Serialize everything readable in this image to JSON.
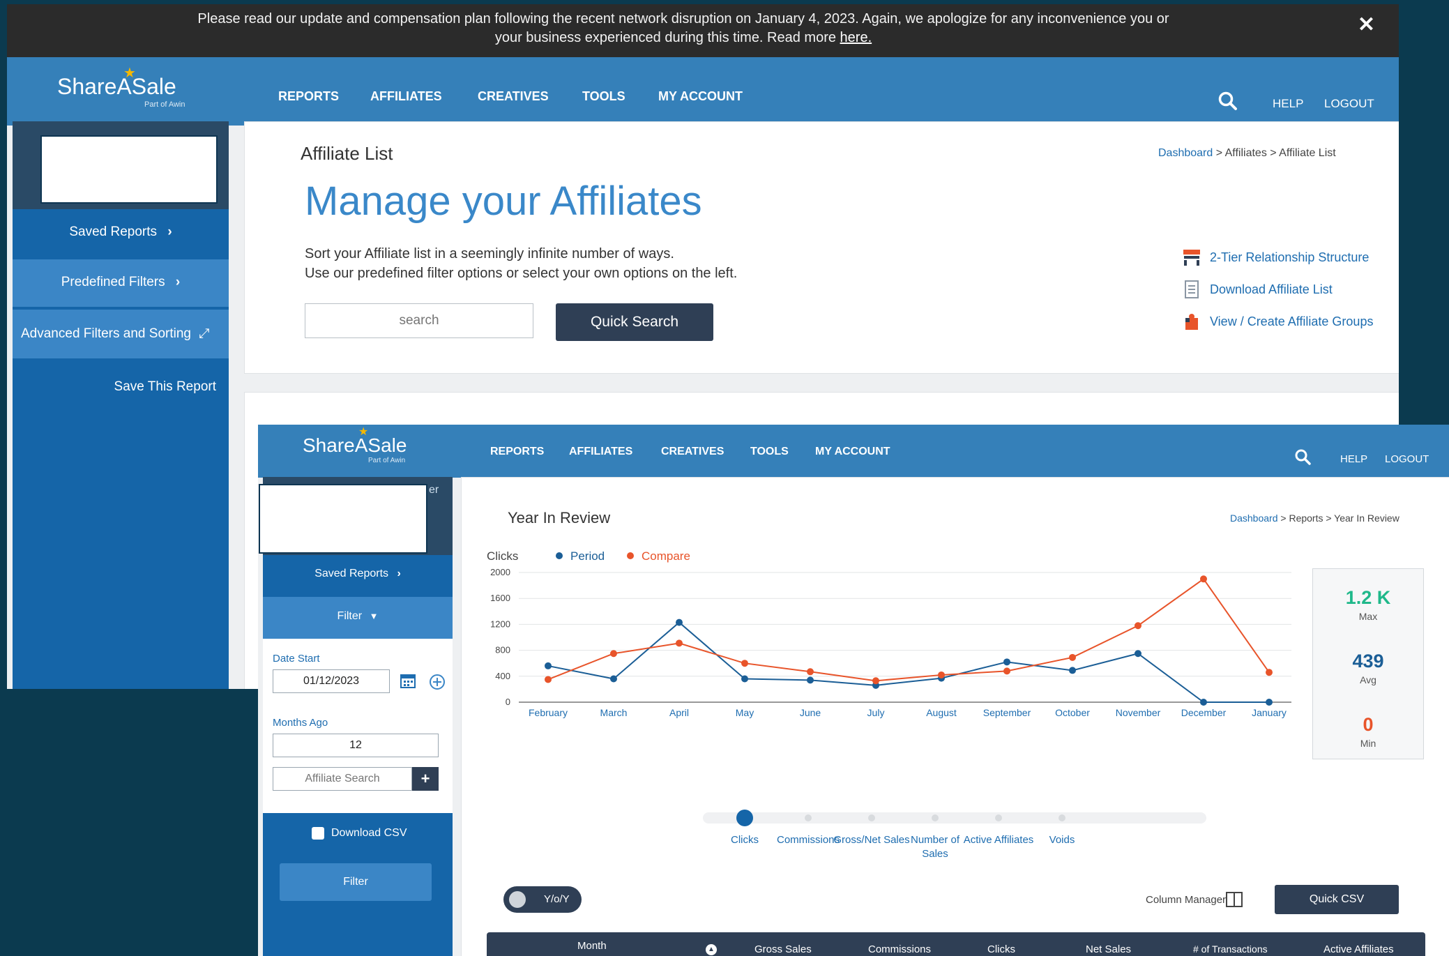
{
  "notice": {
    "line1": "Please read our update and compensation plan following the recent network disruption on January 4, 2023. Again, we apologize for any inconvenience you or",
    "line2": "your business experienced during this time. Read more",
    "link": "here.",
    "close": "✕"
  },
  "brand": {
    "name": "ShareASale",
    "sub": "Part of Awin",
    "star": "★"
  },
  "nav": [
    "REPORTS",
    "AFFILIATES",
    "CREATIVES",
    "TOOLS",
    "MY ACCOUNT"
  ],
  "util": {
    "help": "HELP",
    "logout": "LOGOUT"
  },
  "affiliate_page": {
    "sidebar": {
      "saved_reports": "Saved Reports",
      "predefined_filters": "Predefined Filters",
      "advanced": "Advanced Filters and Sorting",
      "save_report": "Save This Report"
    },
    "section_title": "Affiliate List",
    "breadcrumb": {
      "home": "Dashboard",
      "rest": " > Affiliates > Affiliate List"
    },
    "heading": "Manage your Affiliates",
    "desc1": "Sort your Affiliate list in a seemingly infinite number of ways.",
    "desc2": "Use our predefined filter options or select your own options on the left.",
    "search_placeholder": "search",
    "quick_search": "Quick Search",
    "links": [
      "2-Tier Relationship Structure",
      "Download Affiliate List",
      "View / Create Affiliate Groups"
    ]
  },
  "review_page": {
    "sidebar": {
      "cut_text": "er",
      "saved_reports": "Saved Reports",
      "filter_toggle": "Filter",
      "date_start_label": "Date Start",
      "date_start": "01/12/2023",
      "months_ago_label": "Months Ago",
      "months_ago": "12",
      "affiliate_search_placeholder": "Affiliate Search",
      "add": "+",
      "download_csv": "Download CSV",
      "filter_button": "Filter"
    },
    "section_title": "Year In Review",
    "breadcrumb": {
      "home": "Dashboard",
      "rest": " > Reports > Year In Review"
    },
    "stats": [
      {
        "value": "1.2 K",
        "label": "Max",
        "color": "#1fb88a"
      },
      {
        "value": "439",
        "label": "Avg",
        "color": "#1b5e96"
      },
      {
        "value": "0",
        "label": "Min",
        "color": "#e8542a"
      }
    ],
    "metric_tabs": [
      "Clicks",
      "Commissions",
      "Gross/Net Sales",
      "Number of\nSales",
      "Active Affiliates",
      "Voids"
    ],
    "active_metric": 0,
    "yoy": "Y/o/Y",
    "column_manager": "Column Manager",
    "quick_csv": "Quick CSV",
    "table_headers": [
      "Month",
      "Gross Sales",
      "Commissions",
      "Clicks",
      "Net Sales",
      "# of Transactions",
      "Active Affiliates"
    ]
  },
  "chart_data": {
    "type": "line",
    "ylabel": "Clicks",
    "categories": [
      "February",
      "March",
      "April",
      "May",
      "June",
      "July",
      "August",
      "September",
      "October",
      "November",
      "December",
      "January"
    ],
    "ylim": [
      0,
      2000
    ],
    "yticks": [
      0,
      400,
      800,
      1200,
      1600,
      2000
    ],
    "grid": true,
    "legend_position": "top-left",
    "series": [
      {
        "name": "Period",
        "color": "#1b5e96",
        "values": [
          560,
          360,
          1230,
          360,
          340,
          260,
          370,
          620,
          490,
          750,
          0,
          0
        ]
      },
      {
        "name": "Compare",
        "color": "#e8542a",
        "values": [
          350,
          750,
          910,
          600,
          470,
          330,
          420,
          480,
          690,
          1180,
          1900,
          460
        ]
      }
    ]
  }
}
